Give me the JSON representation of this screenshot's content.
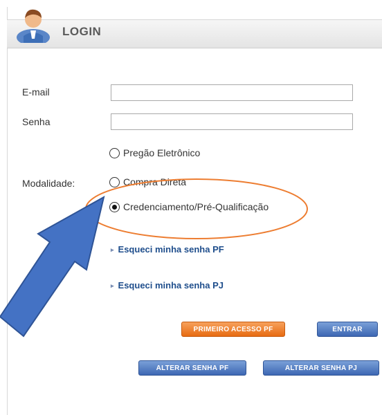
{
  "header": {
    "title": "LOGIN",
    "icon": "user-avatar-icon"
  },
  "form": {
    "email_label": "E-mail",
    "email_value": "",
    "senha_label": "Senha",
    "senha_value": "",
    "modalidade_label": "Modalidade:",
    "options": [
      {
        "label": "Pregão Eletrônico",
        "selected": false
      },
      {
        "label": "Compra Direta",
        "selected": false
      },
      {
        "label": "Credenciamento/Pré-Qualificação",
        "selected": true
      }
    ]
  },
  "links": {
    "forgot_pf": "Esqueci minha senha PF",
    "forgot_pj": "Esqueci minha senha PJ"
  },
  "buttons": {
    "primeiro_acesso": "PRIMEIRO ACESSO PF",
    "entrar": "ENTRAR",
    "alterar_pf": "ALTERAR SENHA PF",
    "alterar_pj": "ALTERAR SENHA PJ"
  },
  "annotations": {
    "arrow_color": "#4472c4",
    "ellipse_color": "#ed7d31"
  }
}
